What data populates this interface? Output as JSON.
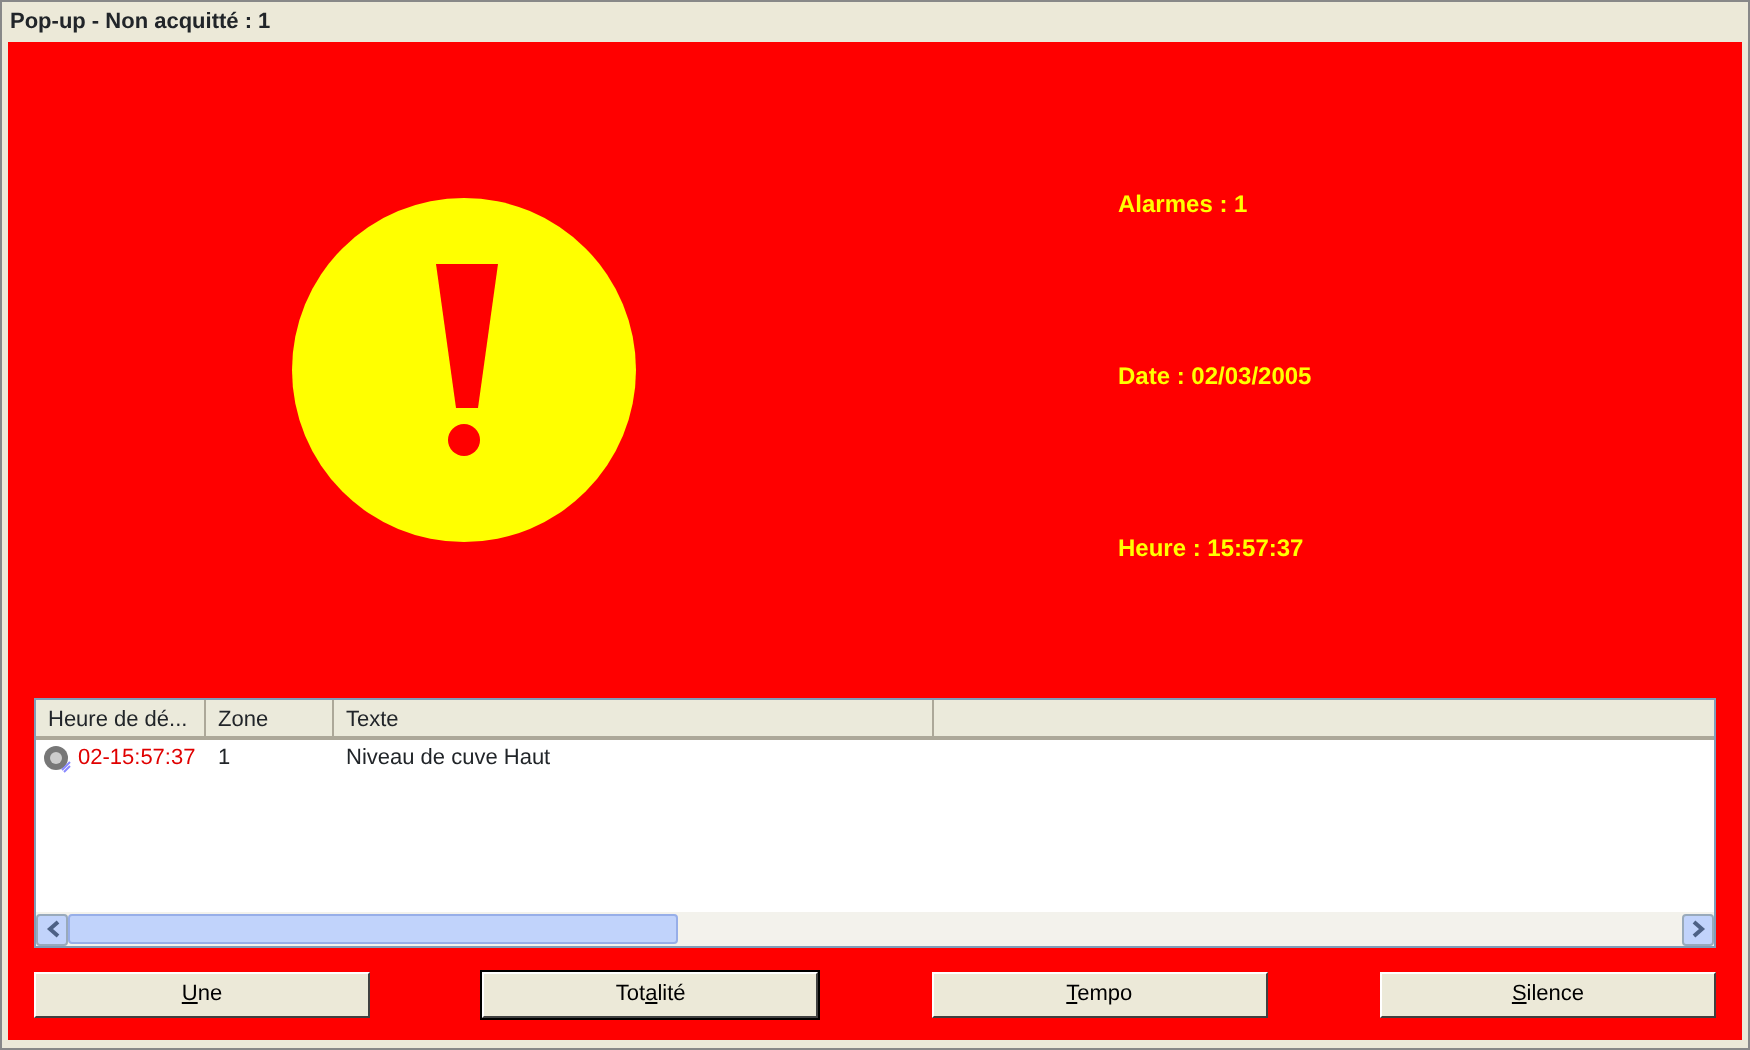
{
  "window": {
    "title": "Pop-up - Non acquitté : 1"
  },
  "info": [
    "Alarmes : 1",
    "Date : 02/03/2005",
    "Heure : 15:57:37"
  ],
  "table": {
    "columns": [
      "Heure de dé...",
      "Zone",
      "Texte"
    ],
    "rows": [
      {
        "time": "02-15:57:37",
        "zone": "1",
        "text": "Niveau de cuve Haut"
      }
    ]
  },
  "buttons": [
    {
      "key": "U",
      "after": "ne",
      "default": false
    },
    {
      "before": "Tot",
      "key": "a",
      "after": "lité",
      "default": true
    },
    {
      "key": "T",
      "after": "empo",
      "default": false
    },
    {
      "key": "S",
      "after": "ilence",
      "default": false
    }
  ]
}
